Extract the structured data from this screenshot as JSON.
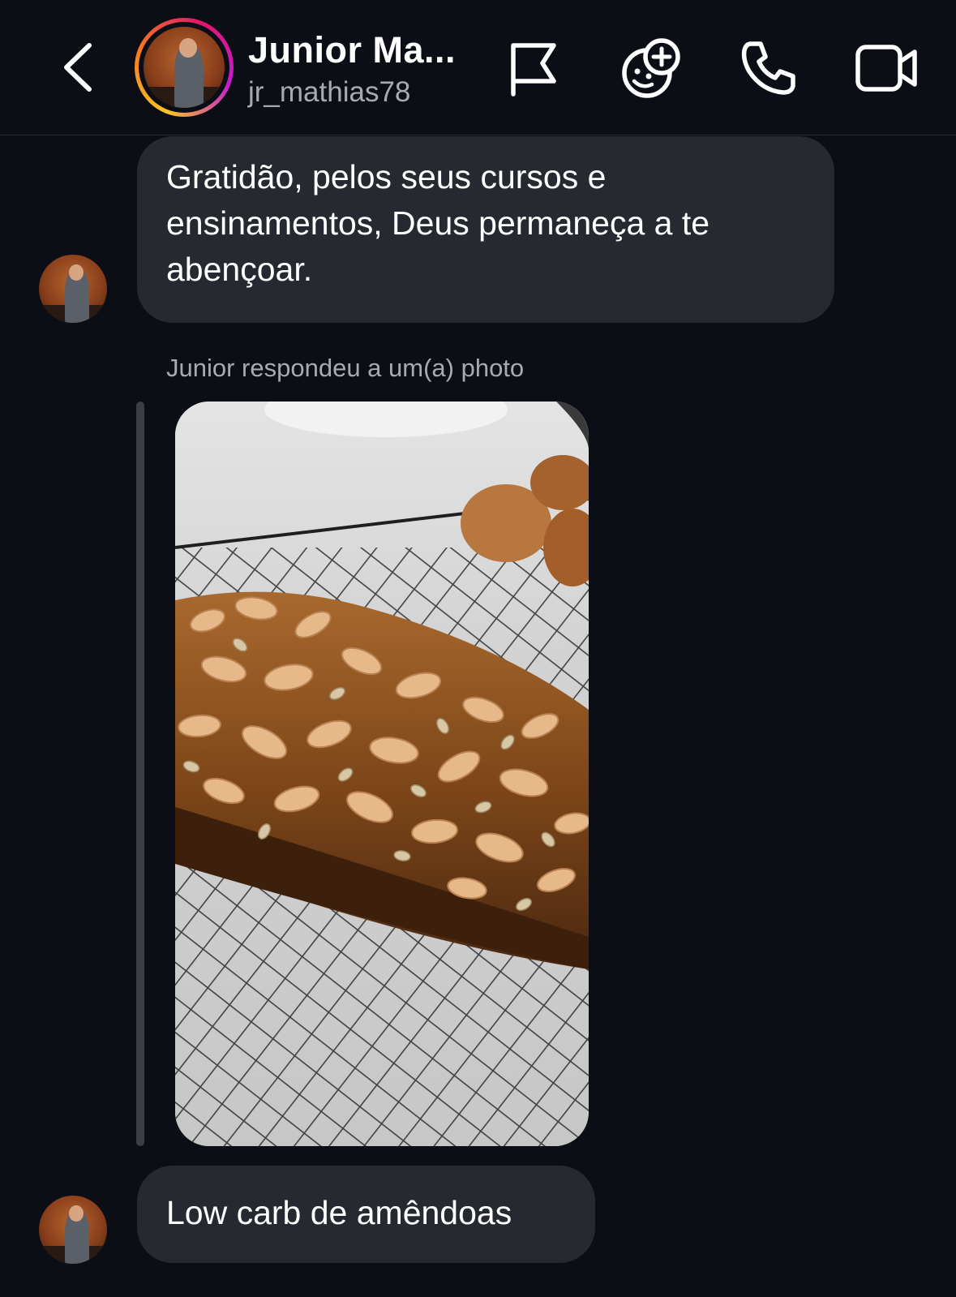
{
  "header": {
    "back_icon": "chevron-left-icon",
    "name": "Junior Ma...",
    "handle": "jr_mathias78",
    "actions": [
      {
        "name": "flag-icon"
      },
      {
        "name": "add-sticker-icon"
      },
      {
        "name": "phone-icon"
      },
      {
        "name": "video-camera-icon"
      }
    ],
    "story_ring_colors": [
      "#f9c52a",
      "#f77a1e",
      "#e3166b",
      "#c21bd0"
    ]
  },
  "messages": [
    {
      "type": "text",
      "text": "Gratidão,  pelos seus cursos e ensinamentos, Deus permaneça a te abençoar."
    },
    {
      "type": "story_reply",
      "caption": "Junior respondeu a um(a) photo",
      "photo_description": "bread-photo"
    },
    {
      "type": "text",
      "text": "Low carb de amêndoas"
    }
  ],
  "colors": {
    "background": "#0b0f15",
    "bubble": "#262a30",
    "secondary_text": "#a6abb3"
  }
}
